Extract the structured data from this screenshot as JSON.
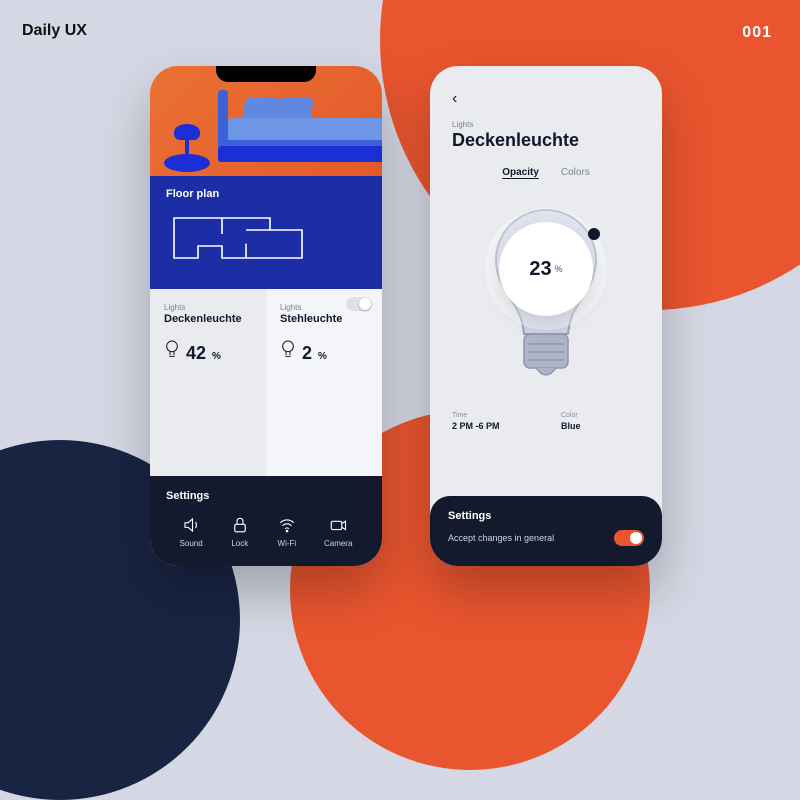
{
  "header": {
    "title": "Daily UX",
    "number": "001"
  },
  "screenA": {
    "floorplan_label": "Floor plan",
    "cards": [
      {
        "category": "Lights",
        "name": "Deckenleuchte",
        "value": "42",
        "unit": "%"
      },
      {
        "category": "Lights",
        "name": "Stehleuchte",
        "value": "2",
        "unit": "%"
      }
    ],
    "settings_label": "Settings",
    "settings_items": [
      {
        "label": "Sound"
      },
      {
        "label": "Lock"
      },
      {
        "label": "Wi-Fi"
      },
      {
        "label": "Camera"
      }
    ]
  },
  "screenB": {
    "category": "Lights",
    "title": "Deckenleuchte",
    "tabs": {
      "opacity": "Opacity",
      "colors": "Colors"
    },
    "dial": {
      "value": "23",
      "unit": "%"
    },
    "meta": {
      "time_label": "Time",
      "time_value": "2 PM -6 PM",
      "color_label": "Color",
      "color_value": "Blue"
    },
    "settings_label": "Settings",
    "accept_label": "Accept changes in general"
  }
}
